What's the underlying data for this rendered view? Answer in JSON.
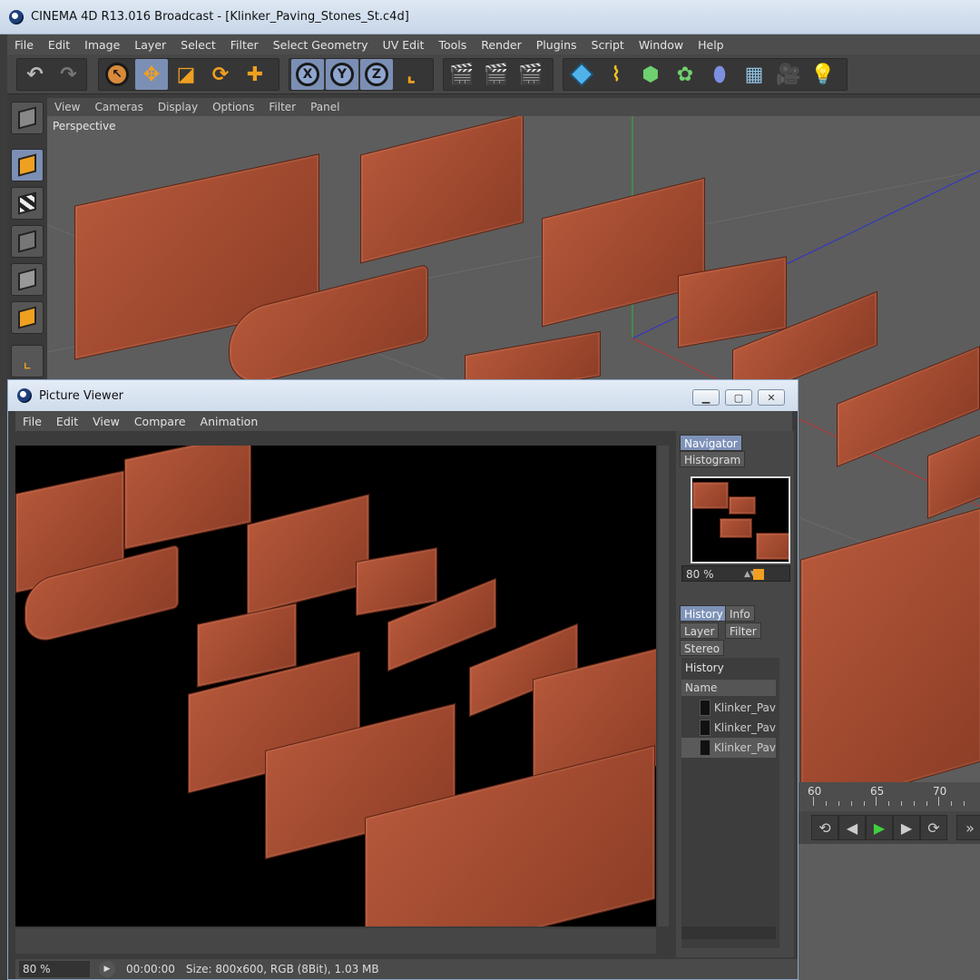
{
  "window": {
    "title": "CINEMA 4D R13.016 Broadcast - [Klinker_Paving_Stones_St.c4d]"
  },
  "main_menu": [
    "File",
    "Edit",
    "Image",
    "Layer",
    "Select",
    "Filter",
    "Select Geometry",
    "UV Edit",
    "Tools",
    "Render",
    "Plugins",
    "Script",
    "Window",
    "Help"
  ],
  "toolbar": {
    "undo": "undo-icon",
    "redo": "redo-icon",
    "axis_x": "X",
    "axis_y": "Y",
    "axis_z": "Z"
  },
  "viewport": {
    "menu": [
      "View",
      "Cameras",
      "Display",
      "Options",
      "Filter",
      "Panel"
    ],
    "label": "Perspective"
  },
  "timeline": {
    "ticks": [
      "60",
      "65",
      "70"
    ]
  },
  "picture_viewer": {
    "title": "Picture Viewer",
    "menu": [
      "File",
      "Edit",
      "View",
      "Compare",
      "Animation"
    ],
    "tabs_top": [
      "Navigator",
      "Histogram"
    ],
    "zoom": "80 %",
    "tabs_bottom": [
      "History",
      "Info",
      "Layer",
      "Filter",
      "Stereo"
    ],
    "history_header": "History",
    "column_name": "Name",
    "history_items": [
      "Klinker_Pav",
      "Klinker_Pav",
      "Klinker_Pav"
    ],
    "status": {
      "zoom": "80 %",
      "time": "00:00:00",
      "info": "Size: 800x600, RGB (8Bit), 1.03 MB"
    }
  },
  "colors": {
    "accent": "#f0a020",
    "selected": "#7b8fb5",
    "brick": "#a54b30"
  }
}
